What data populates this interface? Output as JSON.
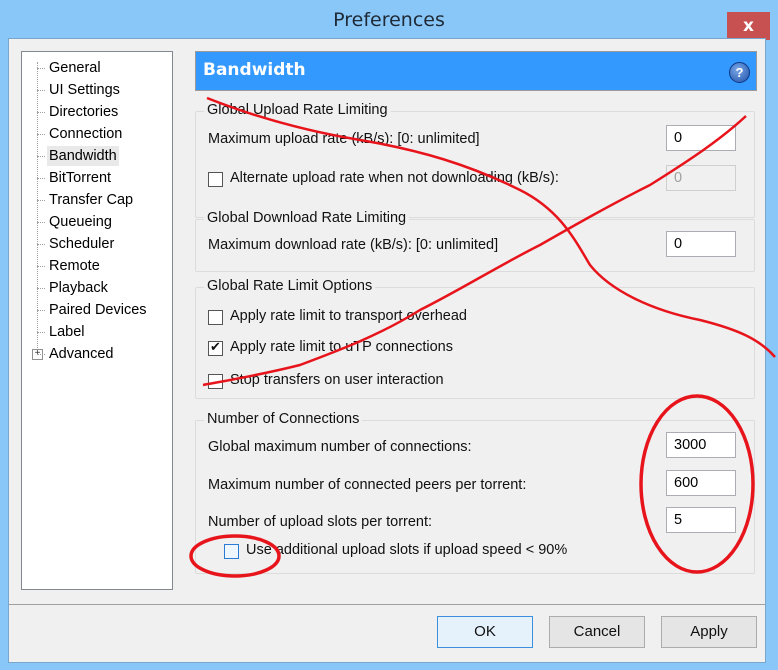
{
  "window": {
    "title": "Preferences",
    "close_label": "x"
  },
  "sidebar": {
    "items": [
      {
        "label": "General",
        "selected": false
      },
      {
        "label": "UI Settings",
        "selected": false
      },
      {
        "label": "Directories",
        "selected": false
      },
      {
        "label": "Connection",
        "selected": false
      },
      {
        "label": "Bandwidth",
        "selected": true
      },
      {
        "label": "BitTorrent",
        "selected": false
      },
      {
        "label": "Transfer Cap",
        "selected": false
      },
      {
        "label": "Queueing",
        "selected": false
      },
      {
        "label": "Scheduler",
        "selected": false
      },
      {
        "label": "Remote",
        "selected": false
      },
      {
        "label": "Playback",
        "selected": false
      },
      {
        "label": "Paired Devices",
        "selected": false
      },
      {
        "label": "Label",
        "selected": false
      },
      {
        "label": "Advanced",
        "selected": false,
        "expandable": true,
        "expander": "+"
      }
    ]
  },
  "header": {
    "title": "Bandwidth",
    "help_icon": "?",
    "color": "#3399ff"
  },
  "upload": {
    "title": "Global Upload Rate Limiting",
    "max_label": "Maximum upload rate (kB/s): [0: unlimited]",
    "max_value": "0",
    "alt_label": "Alternate upload rate when not downloading (kB/s):",
    "alt_checked": false,
    "alt_value": "0"
  },
  "download": {
    "title": "Global Download Rate Limiting",
    "max_label": "Maximum download rate (kB/s): [0: unlimited]",
    "max_value": "0"
  },
  "options": {
    "title": "Global Rate Limit Options",
    "items": [
      {
        "label": "Apply rate limit to transport overhead",
        "checked": false
      },
      {
        "label": "Apply rate limit to uTP connections",
        "checked": true
      },
      {
        "label": "Stop transfers on user interaction",
        "checked": false
      }
    ]
  },
  "connections": {
    "title": "Number of Connections",
    "global_max_label": "Global maximum number of connections:",
    "global_max_value": "3000",
    "peers_label": "Maximum number of connected peers per torrent:",
    "peers_value": "600",
    "slots_label": "Number of upload slots per torrent:",
    "slots_value": "5",
    "extra_slots_label": "Use additional upload slots if upload speed < 90%",
    "extra_slots_checked": false
  },
  "buttons": {
    "ok": "OK",
    "cancel": "Cancel",
    "apply": "Apply"
  },
  "annotation_color": "#e8141c"
}
